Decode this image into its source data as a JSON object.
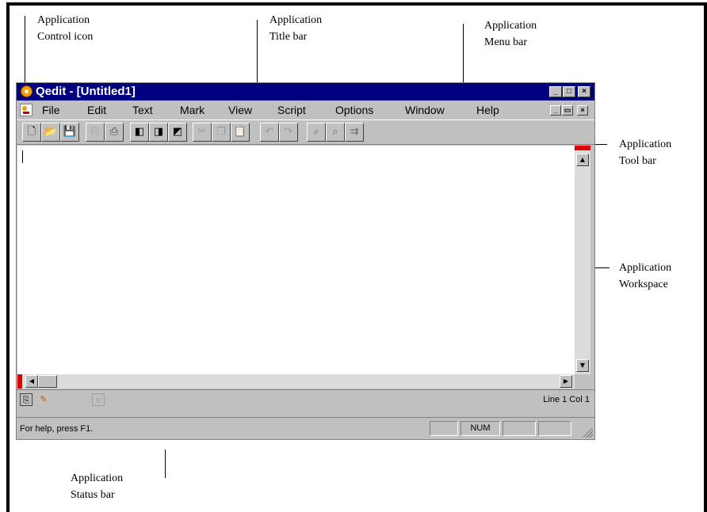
{
  "callouts": {
    "control_icon": [
      "Application",
      "Control icon"
    ],
    "title_bar": [
      "Application",
      "Title bar"
    ],
    "menu_bar": [
      "Application",
      "Menu bar"
    ],
    "tool_bar": [
      "Application",
      "Tool bar"
    ],
    "workspace": [
      "Application",
      "Workspace"
    ],
    "status_bar": [
      "Application",
      "Status bar"
    ]
  },
  "window": {
    "title": "Qedit - [Untitled1]",
    "title_buttons": {
      "minimize": "_",
      "maximize": "□",
      "close": "×"
    },
    "mdi_buttons": {
      "minimize": "_",
      "restore": "▭",
      "close": "×"
    }
  },
  "menu": {
    "items": [
      "File",
      "Edit",
      "Text",
      "Mark",
      "View",
      "Script",
      "Options",
      "Window",
      "Help"
    ]
  },
  "toolbar": {
    "buttons": [
      {
        "name": "new-file",
        "glyph": "🗋",
        "state": "enabled"
      },
      {
        "name": "open-folder",
        "glyph": "📂",
        "state": "enabled"
      },
      {
        "name": "save",
        "glyph": "💾",
        "state": "disabled"
      },
      {
        "name": "save-all",
        "glyph": "⎘",
        "state": "disabled"
      },
      {
        "name": "print",
        "glyph": "⎙",
        "state": "enabled"
      },
      {
        "name": "macro-1",
        "glyph": "◧",
        "state": "enabled"
      },
      {
        "name": "macro-2",
        "glyph": "◨",
        "state": "enabled"
      },
      {
        "name": "macro-3",
        "glyph": "◩",
        "state": "enabled"
      },
      {
        "name": "cut",
        "glyph": "✂",
        "state": "disabled"
      },
      {
        "name": "copy",
        "glyph": "❐",
        "state": "disabled"
      },
      {
        "name": "paste",
        "glyph": "📋",
        "state": "disabled"
      },
      {
        "name": "undo",
        "glyph": "↶",
        "state": "disabled"
      },
      {
        "name": "redo",
        "glyph": "↷",
        "state": "disabled"
      },
      {
        "name": "find",
        "glyph": "⌕",
        "state": "enabled"
      },
      {
        "name": "find-next",
        "glyph": "⌕",
        "state": "enabled"
      },
      {
        "name": "replace",
        "glyph": "⇉",
        "state": "enabled"
      }
    ]
  },
  "editbar": {
    "line_col": "Line 1 Col 1"
  },
  "status": {
    "help_text": "For help, press F1.",
    "num_indicator": "NUM"
  }
}
